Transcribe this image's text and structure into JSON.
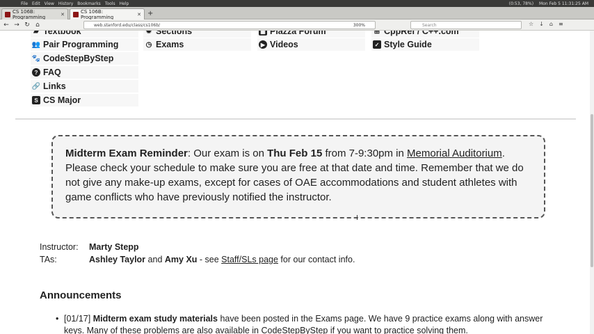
{
  "os_bar": {
    "menu": [
      "File",
      "Edit",
      "View",
      "History",
      "Bookmarks",
      "Tools",
      "Help"
    ],
    "battery": "(0:53, 78%)",
    "clock": "Mon Feb 5  11:31:25 AM"
  },
  "tabs": [
    {
      "label": "CS 106B: Programming"
    },
    {
      "label": "CS 106B: Programming"
    }
  ],
  "url": "web.stanford.edu/class/cs106b/",
  "zoom": "300%",
  "search_placeholder": "Search",
  "nav_links": [
    {
      "label": "Textbook",
      "icon": "book-icon"
    },
    {
      "label": "Sections",
      "icon": "sections-icon"
    },
    {
      "label": "Piazza Forum",
      "icon": "forum-icon"
    },
    {
      "label": "CppRef / C++.com",
      "icon": "reference-icon"
    },
    {
      "label": "Pair Programming",
      "icon": "people-icon"
    },
    {
      "label": "Exams",
      "icon": "clock-icon"
    },
    {
      "label": "Videos",
      "icon": "play-icon"
    },
    {
      "label": "Style Guide",
      "icon": "check-icon"
    },
    {
      "label": "CodeStepByStep",
      "icon": "codestep-icon"
    },
    {
      "label": "FAQ",
      "icon": "question-icon"
    },
    {
      "label": "Links",
      "icon": "link-icon"
    },
    {
      "label": "CS Major",
      "icon": "cs-major-icon"
    }
  ],
  "reminder": {
    "title": "Midterm Exam Reminder",
    "text1": ": Our exam is on ",
    "date": "Thu Feb 15",
    "text2": " from 7-9:30pm in ",
    "location": "Memorial Auditorium",
    "text3": ". Please check your schedule to make sure you are free at that date and time. Remember that we do not give any make-up exams, except for cases of OAE accommodations and student athletes with game conflicts who have previously notified the instructor."
  },
  "staff": {
    "instructor_label": "Instructor:",
    "instructor": "Marty Stepp",
    "tas_label": "TAs:",
    "ta1": "Ashley Taylor",
    "and": " and ",
    "ta2": "Amy Xu",
    "see": " - see ",
    "staff_link": "Staff/SLs page",
    "contact": " for our contact info."
  },
  "announcements": {
    "heading": "Announcements",
    "items": [
      {
        "date": "[01/17]",
        "bold": "Midterm exam study materials",
        "text": " have been posted in the Exams page. We have 9 practice exams along with answer keys. Many of these problems are also available in CodeStepByStep if you want to practice solving them."
      }
    ]
  }
}
